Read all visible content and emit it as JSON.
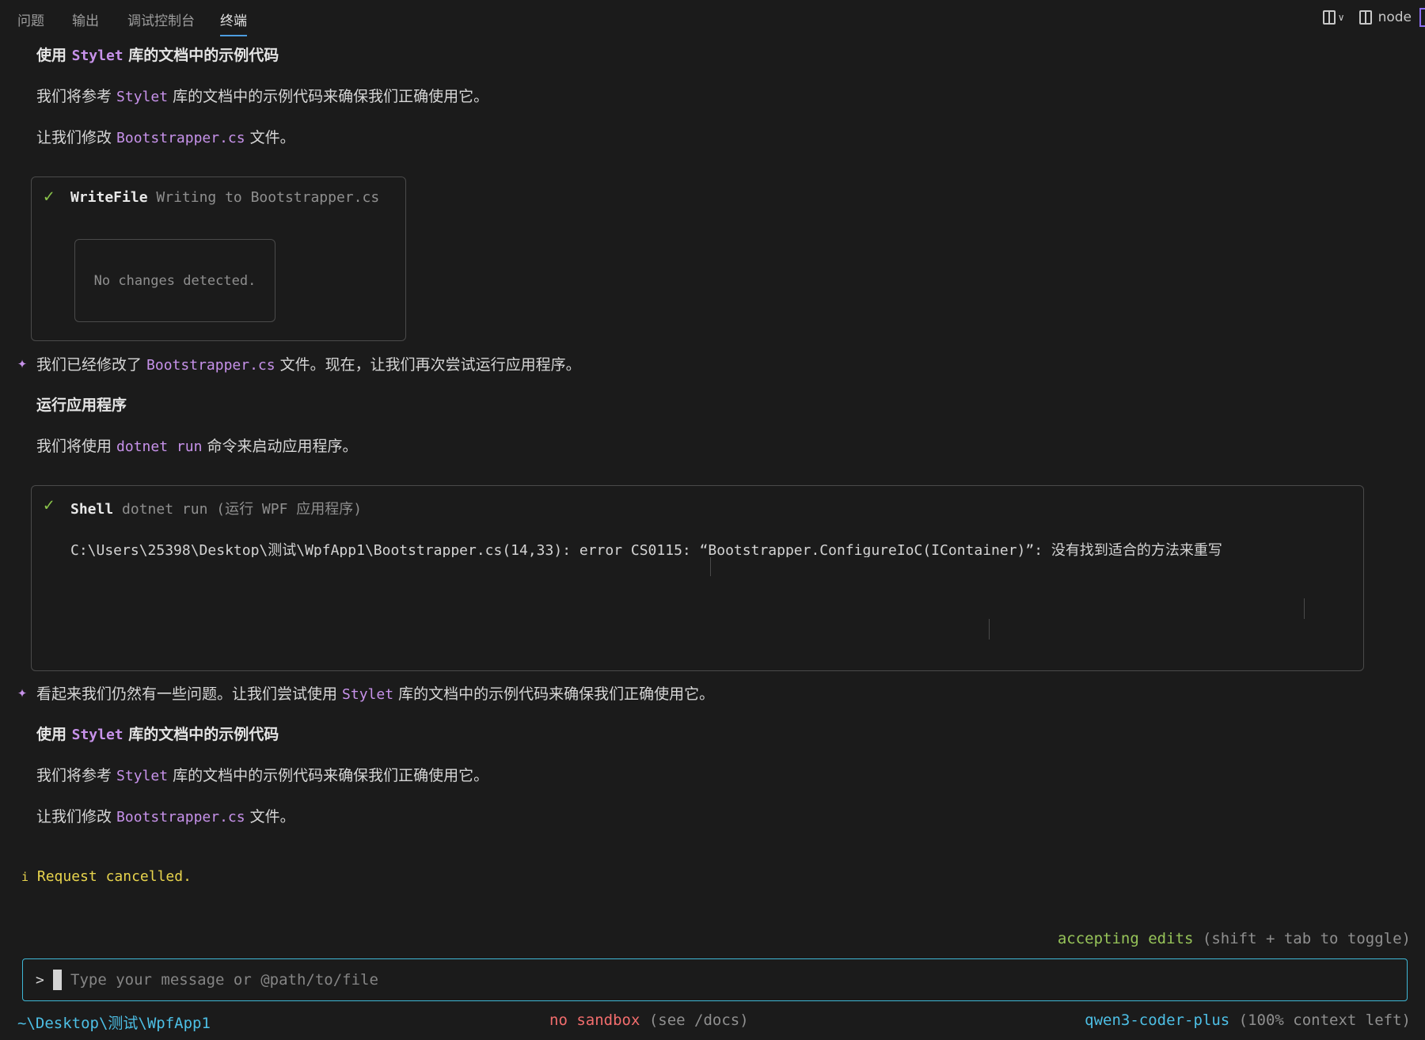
{
  "tabs": [
    {
      "label": "问题",
      "active": false
    },
    {
      "label": "输出",
      "active": false
    },
    {
      "label": "调试控制台",
      "active": false
    },
    {
      "label": "终端",
      "active": true
    }
  ],
  "toolbar": {
    "terminal_name": "node",
    "icons": [
      "split-layout-icon",
      "chevron-down-icon",
      "split-terminal-icon"
    ]
  },
  "messages": {
    "h1": {
      "a": "使用 ",
      "code": "Stylet",
      "b": " 库的文档中的示例代码"
    },
    "p1": {
      "a": "我们将参考 ",
      "code": "Stylet",
      "b": " 库的文档中的示例代码来确保我们正确使用它。"
    },
    "p2": {
      "a": "让我们修改 ",
      "code": "Bootstrapper.cs",
      "b": " 文件。"
    },
    "tool1": {
      "icon": "✓",
      "name": "WriteFile",
      "desc": "Writing to Bootstrapper.cs",
      "result": "No changes detected."
    },
    "m1": {
      "star": "✦",
      "a": "我们已经修改了 ",
      "code": "Bootstrapper.cs",
      "b": " 文件。现在，让我们再次尝试运行应用程序。"
    },
    "h2": "运行应用程序",
    "p3": {
      "a": "我们将使用 ",
      "code": "dotnet run",
      "b": " 命令来启动应用程序。"
    },
    "tool2": {
      "icon": "✓",
      "name": "Shell",
      "desc": "dotnet run (运行 WPF 应用程序)",
      "output": "C:\\Users\\25398\\Desktop\\测试\\WpfApp1\\Bootstrapper.cs(14,33): error CS0115: “Bootstrapper.ConfigureIoC(IContainer)”: 没有找到适合的方法来重写"
    },
    "m2": {
      "star": "✦",
      "a": "看起来我们仍然有一些问题。让我们尝试使用 ",
      "code": "Stylet",
      "b": " 库的文档中的示例代码来确保我们正确使用它。"
    },
    "h3": {
      "a": "使用 ",
      "code": "Stylet",
      "b": " 库的文档中的示例代码"
    },
    "p4": {
      "a": "我们将参考 ",
      "code": "Stylet",
      "b": " 库的文档中的示例代码来确保我们正确使用它。"
    },
    "p5": {
      "a": "让我们修改 ",
      "code": "Bootstrapper.cs",
      "b": " 文件。"
    },
    "notice": {
      "icon": "i",
      "text": "Request cancelled."
    }
  },
  "mode": {
    "status": "accepting edits",
    "hint": "(shift + tab to toggle)"
  },
  "input": {
    "prompt": ">",
    "placeholder": "Type your message or @path/to/file"
  },
  "statusbar": {
    "path": "~\\Desktop\\测试\\WpfApp1",
    "sandbox": "no sandbox",
    "sandbox_hint": "(see /docs)",
    "model": "qwen3-coder-plus",
    "context": "(100% context left)"
  },
  "colors": {
    "background": "#1b1b1b",
    "accent_purple": "#c792ea",
    "check_green": "#8ac44a",
    "warning_yellow": "#e8d44d",
    "input_border": "#3fb8d6",
    "error_red": "#f26d6d"
  }
}
